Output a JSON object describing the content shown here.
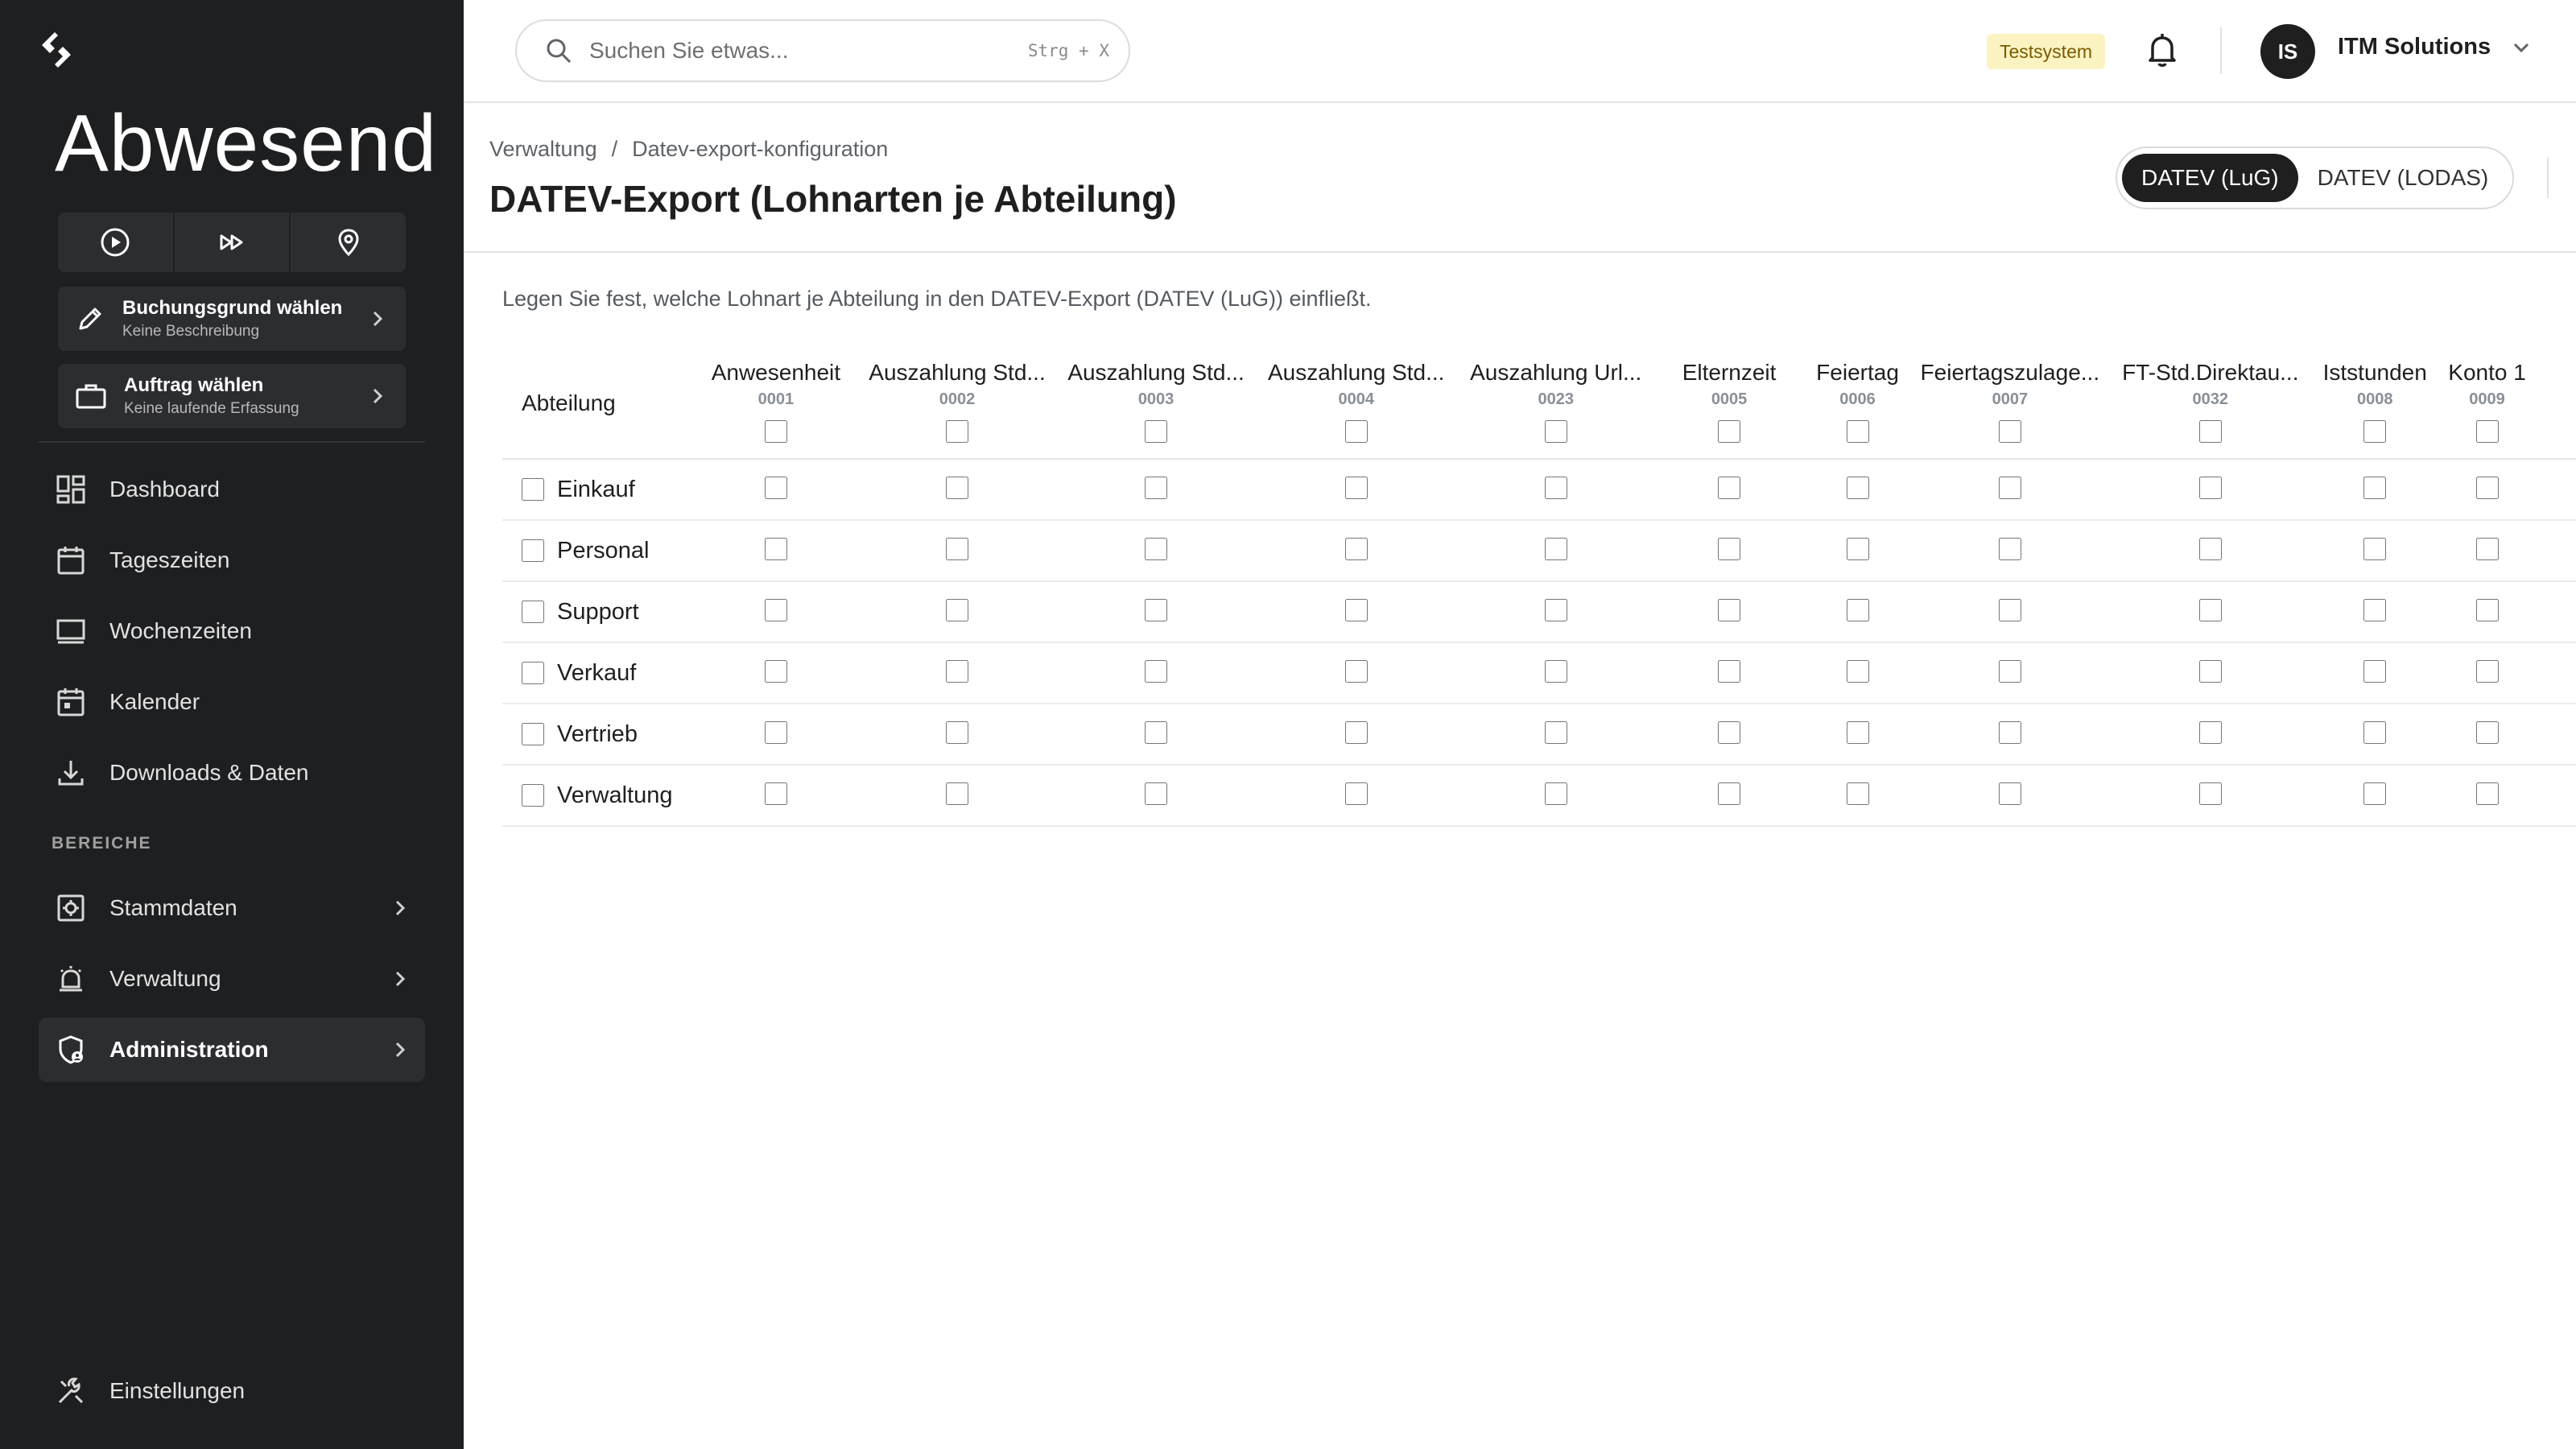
{
  "app": {
    "status_title": "Abwesend",
    "quick_actions": [
      {
        "icon": "play-icon"
      },
      {
        "icon": "fast-forward-icon"
      },
      {
        "icon": "location-pin-icon"
      }
    ],
    "booking_card": {
      "title": "Buchungsgrund wählen",
      "subtitle": "Keine Beschreibung"
    },
    "order_card": {
      "title": "Auftrag wählen",
      "subtitle": "Keine laufende Erfassung"
    }
  },
  "sidebar": {
    "items": [
      {
        "label": "Dashboard",
        "icon": "dashboard-icon"
      },
      {
        "label": "Tageszeiten",
        "icon": "calendar-icon"
      },
      {
        "label": "Wochenzeiten",
        "icon": "monitor-icon"
      },
      {
        "label": "Kalender",
        "icon": "calendar-event-icon"
      },
      {
        "label": "Downloads & Daten",
        "icon": "download-icon"
      }
    ],
    "section_label": "BEREICHE",
    "sections": [
      {
        "label": "Stammdaten",
        "icon": "settings-box-icon"
      },
      {
        "label": "Verwaltung",
        "icon": "alarm-icon"
      },
      {
        "label": "Administration",
        "icon": "admin-shield-icon",
        "active": true
      }
    ],
    "settings_label": "Einstellungen"
  },
  "topbar": {
    "search_placeholder": "Suchen Sie etwas...",
    "search_shortcut": "Strg + X",
    "env_badge": "Testsystem",
    "avatar_initials": "IS",
    "org_name": "ITM Solutions"
  },
  "header": {
    "breadcrumb": [
      "Verwaltung",
      "/",
      "Datev-export-konfiguration"
    ],
    "title": "DATEV-Export (Lohnarten je Abteilung)",
    "toggle_options": [
      "DATEV (LuG)",
      "DATEV (LODAS)"
    ],
    "toggle_active": "DATEV (LuG)"
  },
  "main": {
    "description": "Legen Sie fest, welche Lohnart je Abteilung in den DATEV-Export (DATEV (LuG)) einfließt.",
    "first_column_header": "Abteilung",
    "columns": [
      {
        "name": "Anwesenheit",
        "code": "0001"
      },
      {
        "name": "Auszahlung Std...",
        "code": "0002"
      },
      {
        "name": "Auszahlung Std...",
        "code": "0003"
      },
      {
        "name": "Auszahlung Std...",
        "code": "0004"
      },
      {
        "name": "Auszahlung Url...",
        "code": "0023"
      },
      {
        "name": "Elternzeit",
        "code": "0005"
      },
      {
        "name": "Feiertag",
        "code": "0006"
      },
      {
        "name": "Feiertagszulage...",
        "code": "0007"
      },
      {
        "name": "FT-Std.Direktau...",
        "code": "0032"
      },
      {
        "name": "Iststunden",
        "code": "0008"
      },
      {
        "name": "Konto 1",
        "code": "0009"
      }
    ],
    "departments": [
      "Einkauf",
      "Personal",
      "Support",
      "Verkauf",
      "Vertrieb",
      "Verwaltung"
    ]
  }
}
